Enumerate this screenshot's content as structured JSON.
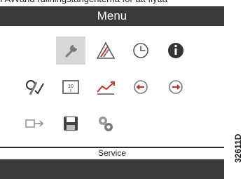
{
  "caption": "I Avvänd rullningstangenterna för att flytta",
  "window": {
    "title": "Menu"
  },
  "status": {
    "label": "Service"
  },
  "figure_code": "32611D",
  "icons": {
    "row1": [
      "wrench-icon",
      "warning-icon",
      "clock-icon",
      "info-icon"
    ],
    "row2": [
      "settings-check-icon",
      "counter-icon",
      "trend-icon",
      "back-arrow-icon",
      "forward-arrow-icon"
    ],
    "row3": [
      "ethernet-icon",
      "save-icon",
      "gears-icon"
    ]
  },
  "colors": {
    "bar": "#3a3a3a",
    "selected": "#d8d8d8",
    "icon_gray": "#7a7a7a",
    "icon_red": "#c0392b",
    "icon_dark": "#333333"
  }
}
